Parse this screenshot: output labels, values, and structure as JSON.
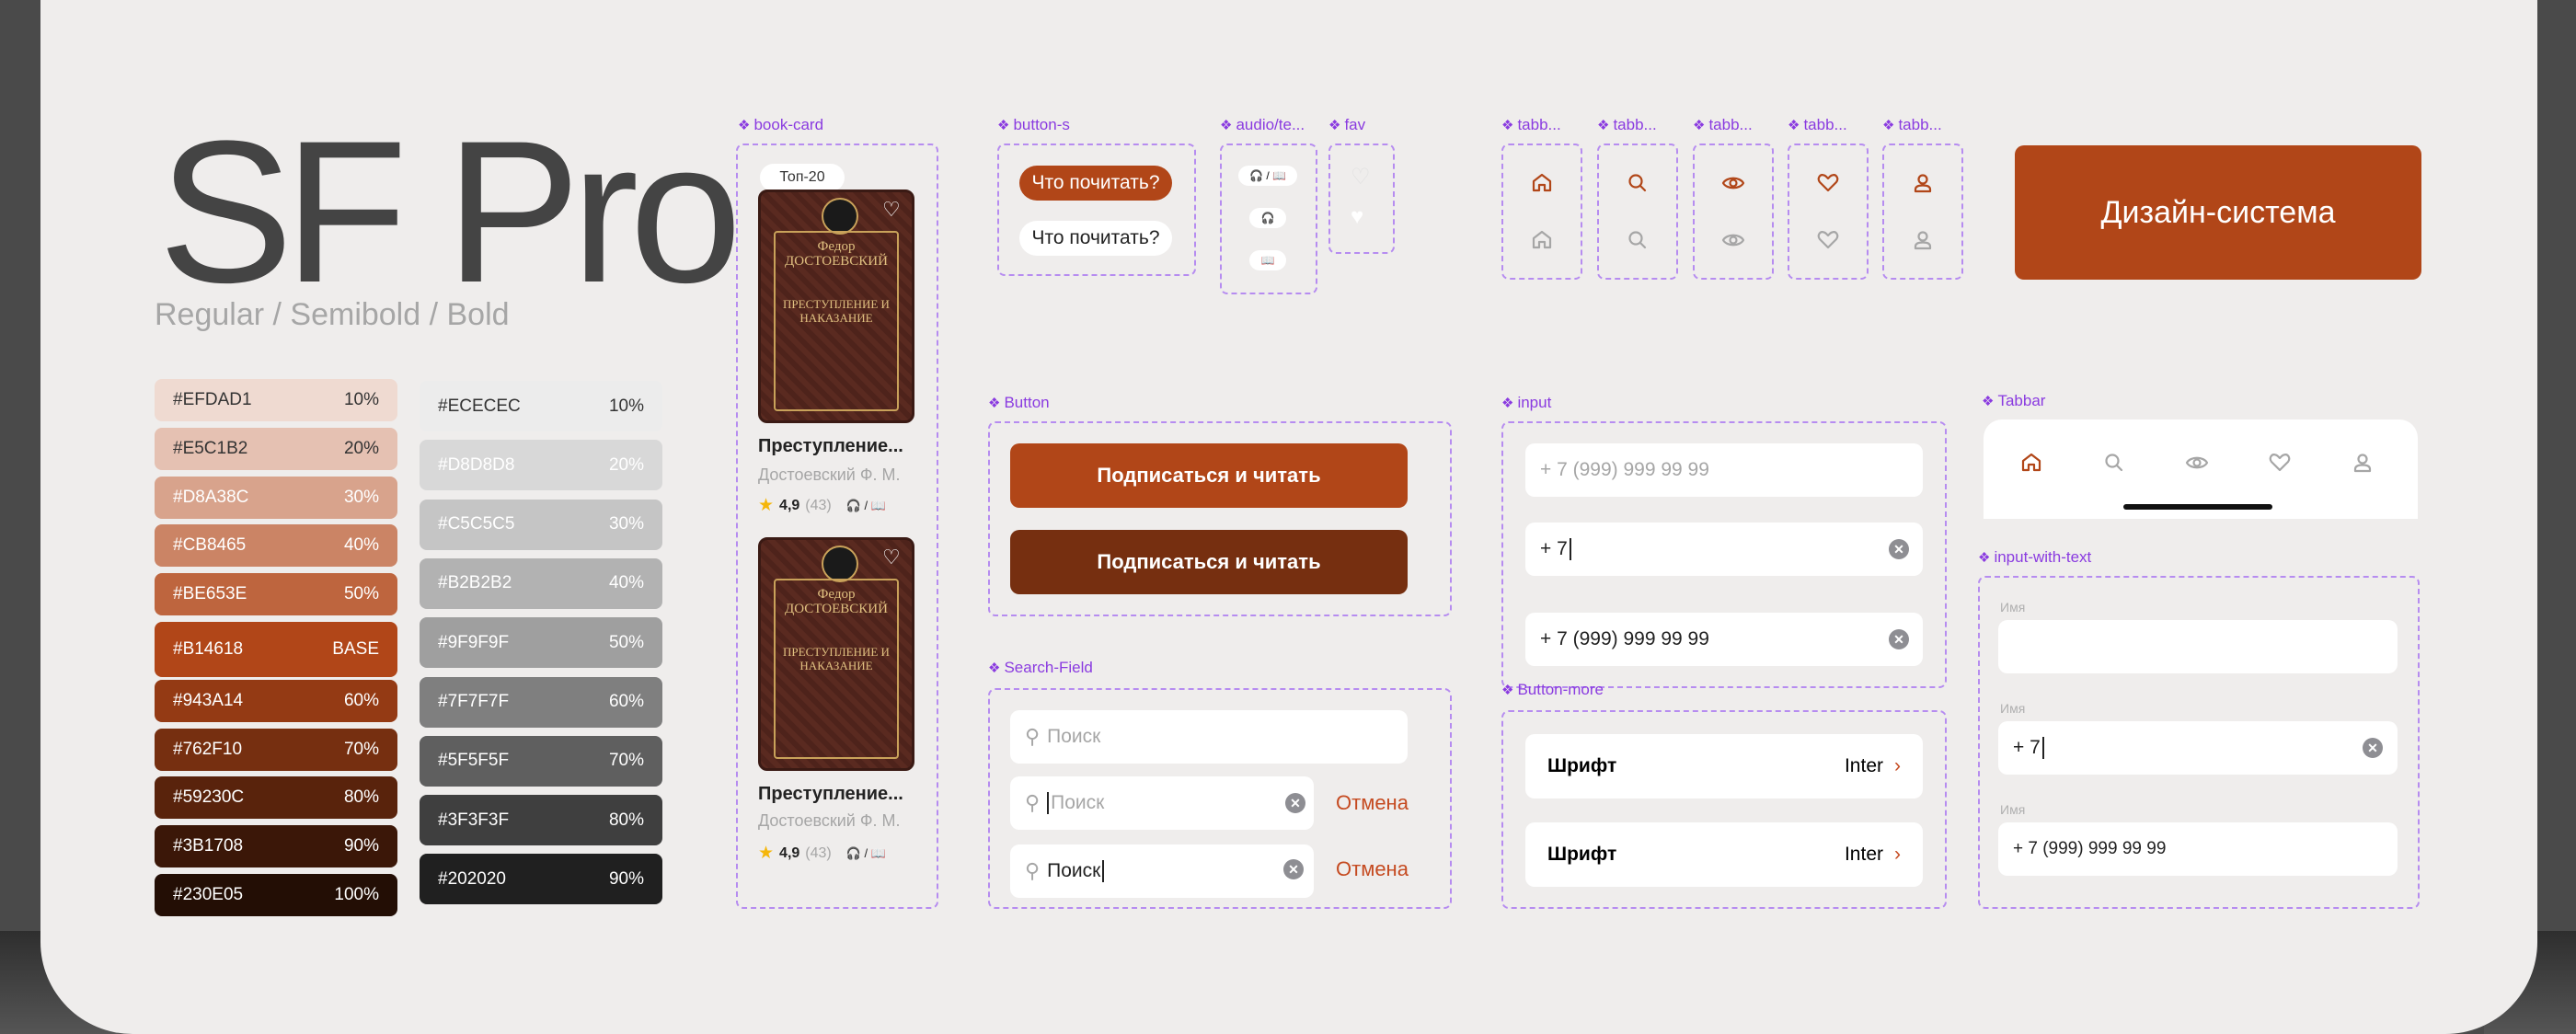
{
  "title": {
    "main": "SF Pro",
    "weights": "Regular / Semibold / Bold"
  },
  "palette": {
    "accent": [
      {
        "hex": "#EFDAD1",
        "label": "10%",
        "bg": "#efdad1",
        "fg": "#333333"
      },
      {
        "hex": "#E5C1B2",
        "label": "20%",
        "bg": "#e5c1b2",
        "fg": "#333333"
      },
      {
        "hex": "#D8A38C",
        "label": "30%",
        "bg": "#d8a38c",
        "fg": "#ffffff"
      },
      {
        "hex": "#CB8465",
        "label": "40%",
        "bg": "#cb8465",
        "fg": "#ffffff"
      },
      {
        "hex": "#BE653E",
        "label": "50%",
        "bg": "#be653e",
        "fg": "#ffffff"
      },
      {
        "hex": "#B14618",
        "label": "BASE",
        "bg": "#b14618",
        "fg": "#ffffff"
      },
      {
        "hex": "#943A14",
        "label": "60%",
        "bg": "#943a14",
        "fg": "#ffffff"
      },
      {
        "hex": "#762F10",
        "label": "70%",
        "bg": "#762f10",
        "fg": "#ffffff"
      },
      {
        "hex": "#59230C",
        "label": "80%",
        "bg": "#59230c",
        "fg": "#ffffff"
      },
      {
        "hex": "#3B1708",
        "label": "90%",
        "bg": "#3b1708",
        "fg": "#ffffff"
      },
      {
        "hex": "#230E05",
        "label": "100%",
        "bg": "#230e05",
        "fg": "#ffffff"
      }
    ],
    "gray": [
      {
        "hex": "#ECECEC",
        "label": "10%",
        "bg": "#ececec",
        "fg": "#333333"
      },
      {
        "hex": "#D8D8D8",
        "label": "20%",
        "bg": "#d8d8d8",
        "fg": "#ffffff"
      },
      {
        "hex": "#C5C5C5",
        "label": "30%",
        "bg": "#c5c5c5",
        "fg": "#ffffff"
      },
      {
        "hex": "#B2B2B2",
        "label": "40%",
        "bg": "#b2b2b2",
        "fg": "#ffffff"
      },
      {
        "hex": "#9F9F9F",
        "label": "50%",
        "bg": "#9f9f9f",
        "fg": "#ffffff"
      },
      {
        "hex": "#7F7F7F",
        "label": "60%",
        "bg": "#7f7f7f",
        "fg": "#ffffff"
      },
      {
        "hex": "#5F5F5F",
        "label": "70%",
        "bg": "#5f5f5f",
        "fg": "#ffffff"
      },
      {
        "hex": "#3F3F3F",
        "label": "80%",
        "bg": "#3f3f3f",
        "fg": "#ffffff"
      },
      {
        "hex": "#202020",
        "label": "90%",
        "bg": "#202020",
        "fg": "#ffffff"
      }
    ]
  },
  "components": {
    "book_card": {
      "label": "book-card",
      "badge": "Топ-20",
      "cover_author": "Федор ДОСТОЕВСКИЙ",
      "cover_title": "ПРЕСТУПЛЕНИЕ И НАКАЗАНИЕ",
      "name": "Преступление...",
      "author": "Достоевский Ф. М.",
      "rating": "4,9",
      "count": "(43)",
      "formats": "🎧 / 📖"
    },
    "button_s": {
      "label": "button-s",
      "primary": "Что почитать?",
      "secondary": "Что почитать?"
    },
    "audio_text": {
      "label": "audio/te...",
      "both": "🎧 / 📖",
      "audio": "🎧",
      "text": "📖"
    },
    "fav": {
      "label": "fav"
    },
    "tabbar_items": [
      "tabb...",
      "tabb...",
      "tabb...",
      "tabb...",
      "tabb..."
    ],
    "design_system": "Дизайн-система",
    "button": {
      "label": "Button",
      "primary": "Подписаться и читать",
      "dark": "Подписаться и читать"
    },
    "input": {
      "label": "input",
      "placeholder": "+ 7 (999) 999 99 99",
      "typing": "+ 7",
      "filled": "+ 7 (999) 999 99 99"
    },
    "tabbar": {
      "label": "Tabbar"
    },
    "search_field": {
      "label": "Search-Field",
      "placeholder": "Поиск",
      "active_placeholder": "Поиск",
      "value": "Поиск",
      "cancel": "Отмена"
    },
    "button_more": {
      "label": "Button-more",
      "rows": [
        {
          "title": "Шрифт",
          "value": "Inter"
        },
        {
          "title": "Шрифт",
          "value": "Inter"
        }
      ]
    },
    "input_with_text": {
      "label": "input-with-text",
      "field_label": "Имя",
      "typing": "+ 7",
      "filled": "+ 7 (999) 999 99 99"
    }
  },
  "colors": {
    "accent": "#B14618",
    "dark_accent": "#762F10",
    "frame": "#B68CF0",
    "label": "#8A3BE0"
  },
  "icons": [
    "home-icon",
    "search-icon",
    "eye-icon",
    "heart-icon",
    "user-icon",
    "headphones-icon",
    "book-icon",
    "star-icon",
    "clear-icon",
    "chevron-right-icon"
  ]
}
